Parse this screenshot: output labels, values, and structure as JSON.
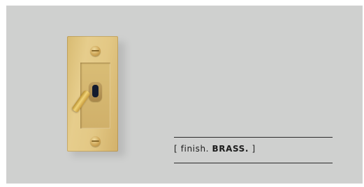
{
  "caption": {
    "open_bracket": "[ finish. ",
    "finish": "BRASS.",
    "close_bracket": " ]"
  },
  "colors": {
    "background": "#cfd0cf",
    "brass": "#e3c885",
    "rule": "#2a2a2a"
  }
}
